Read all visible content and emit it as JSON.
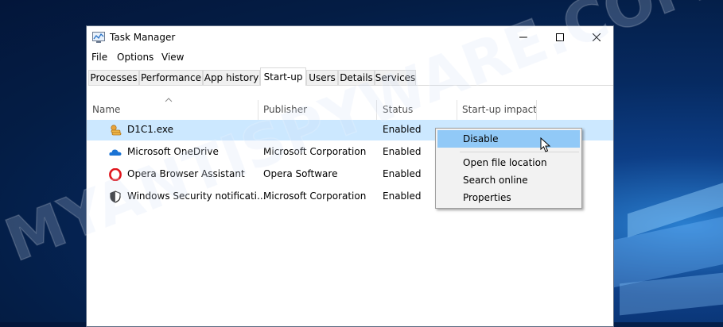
{
  "window": {
    "title": "Task Manager",
    "controls": {
      "minimize": "minimize-icon",
      "maximize": "maximize-icon",
      "close": "close-icon"
    }
  },
  "menu": [
    {
      "label": "File"
    },
    {
      "label": "Options"
    },
    {
      "label": "View"
    }
  ],
  "tabs": [
    {
      "label": "Processes",
      "active": false
    },
    {
      "label": "Performance",
      "active": false
    },
    {
      "label": "App history",
      "active": false
    },
    {
      "label": "Start-up",
      "active": true
    },
    {
      "label": "Users",
      "active": false
    },
    {
      "label": "Details",
      "active": false
    },
    {
      "label": "Services",
      "active": false
    }
  ],
  "columns": [
    {
      "label": "Name"
    },
    {
      "label": "Publisher"
    },
    {
      "label": "Status"
    },
    {
      "label": "Start-up impact"
    }
  ],
  "rows": [
    {
      "icon": "d1c1-exe-icon",
      "name": "D1C1.exe",
      "publisher": "",
      "status": "Enabled",
      "selected": true
    },
    {
      "icon": "onedrive-icon",
      "name": "Microsoft OneDrive",
      "publisher": "Microsoft Corporation",
      "status": "Enabled",
      "selected": false
    },
    {
      "icon": "opera-icon",
      "name": "Opera Browser Assistant",
      "publisher": "Opera Software",
      "status": "Enabled",
      "selected": false
    },
    {
      "icon": "shield-icon",
      "name": "Windows Security notificati...",
      "publisher": "Microsoft Corporation",
      "status": "Enabled",
      "selected": false
    }
  ],
  "context_menu": {
    "items": [
      {
        "label": "Disable",
        "hover": true
      },
      {
        "label": "Open file location",
        "hover": false
      },
      {
        "label": "Search online",
        "hover": false
      },
      {
        "label": "Properties",
        "hover": false
      }
    ]
  },
  "watermark": {
    "text": "MYANTISPYWARE.COM"
  },
  "colors": {
    "selected_row": "#cce8ff",
    "menu_hover": "#91c9f7",
    "window_bg": "#ffffff",
    "desktop": "#062a61"
  }
}
